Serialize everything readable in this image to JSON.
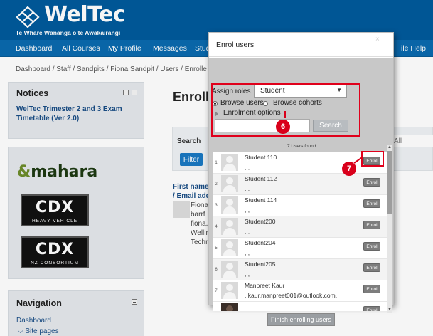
{
  "header": {
    "logo": "WelTec",
    "tagline": "Te Whare Wānanga o te Awakairangi"
  },
  "navbar": {
    "items": [
      "Dashboard",
      "All Courses",
      "My Profile",
      "Messages",
      "Stud",
      "ile Help"
    ]
  },
  "breadcrumb": "Dashboard / Staff / Sandpits / Fiona Sandpit / Users / Enrolle",
  "notices": {
    "title": "Notices",
    "link": "WelTec Trimester 2 and 3 Exam Timetable (Ver 2.0)"
  },
  "logos": {
    "mahara": "mahara",
    "cdx1_big": "CDX",
    "cdx1_small": "HEAVY VEHICLE",
    "cdx2_big": "CDX",
    "cdx2_small": "NZ CONSORTIUM"
  },
  "navigation": {
    "title": "Navigation",
    "dashboard": "Dashboard",
    "site_pages": "Site pages"
  },
  "main": {
    "title": "Enroll",
    "search_label": "Search",
    "filter_label": "Filter",
    "select_value": "All",
    "col_header_1": "First name",
    "col_header_2": "/ Email addr",
    "user_lines": [
      "Fiona",
      "barrf",
      "fiona.",
      "Wellin",
      "Techn"
    ]
  },
  "dialog": {
    "title": "Enrol users",
    "close": "×",
    "assign_roles_label": "Assign roles",
    "role_value": "Student",
    "browse_users": "Browse users",
    "browse_cohorts": "Browse cohorts",
    "enrolment_options": "Enrolment options",
    "search_placeholder": "",
    "search_button": "Search",
    "users_found": "7 Users found",
    "enrol_label": "Enrol",
    "finish_button": "Finish enrolling users",
    "users": [
      {
        "index": "1",
        "name": "Student 110",
        "email": ", ,"
      },
      {
        "index": "2",
        "name": "Student 112",
        "email": ", ,"
      },
      {
        "index": "3",
        "name": "Student 114",
        "email": ", ,"
      },
      {
        "index": "4",
        "name": "Student200",
        "email": ", ,"
      },
      {
        "index": "5",
        "name": "Student204",
        "email": ", ,"
      },
      {
        "index": "6",
        "name": "Student205",
        "email": ", ,"
      },
      {
        "index": "7",
        "name": "Manpreet Kaur",
        "email": ", kaur.manpreet001@outlook.com,"
      }
    ]
  },
  "markers": {
    "step6": "6",
    "step7": "7"
  },
  "colors": {
    "brand_blue": "#005a9c",
    "highlight_red": "#e0001b"
  }
}
